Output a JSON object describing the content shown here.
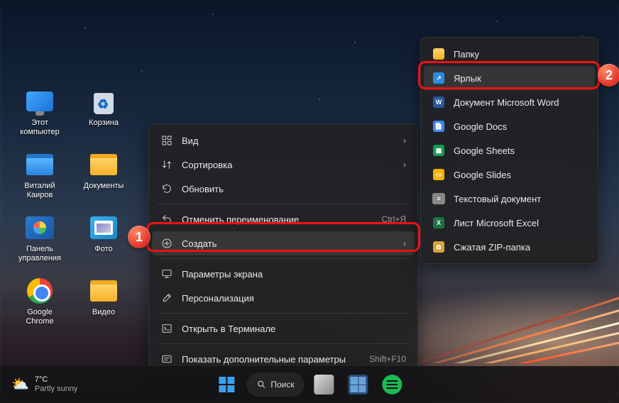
{
  "desktop_icons": {
    "this_pc": "Этот компьютер",
    "recycle": "Корзина",
    "user": "Виталий Каиров",
    "documents": "Документы",
    "control_panel": "Панель управления",
    "photos": "Фото",
    "chrome": "Google Chrome",
    "video": "Видео"
  },
  "context_menu": {
    "view": "Вид",
    "sort": "Сортировка",
    "refresh": "Обновить",
    "undo_rename": "Отменить переименование",
    "undo_shortcut": "Ctrl+Я",
    "new": "Создать",
    "display": "Параметры экрана",
    "personalize": "Персонализация",
    "terminal": "Открыть в Терминале",
    "more": "Показать дополнительные параметры",
    "more_shortcut": "Shift+F10"
  },
  "new_submenu": {
    "folder": "Папку",
    "shortcut": "Ярлык",
    "word": "Документ Microsoft Word",
    "gdocs": "Google Docs",
    "gsheets": "Google Sheets",
    "gslides": "Google Slides",
    "txt": "Текстовый документ",
    "excel": "Лист Microsoft Excel",
    "zip": "Сжатая ZIP-папка"
  },
  "annotations": {
    "one": "1",
    "two": "2"
  },
  "taskbar": {
    "temp": "7°C",
    "condition": "Partly sunny",
    "search": "Поиск"
  }
}
